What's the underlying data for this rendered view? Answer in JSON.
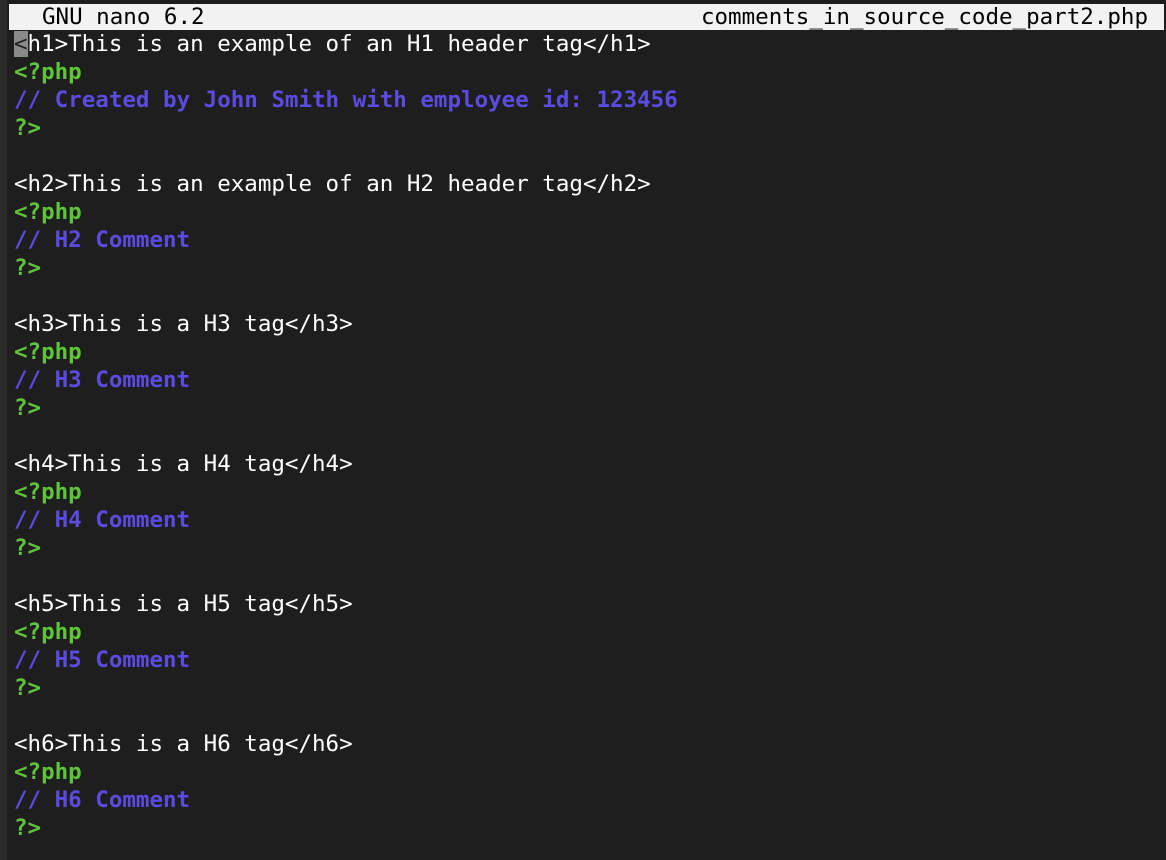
{
  "title_bar": {
    "app_name": "GNU nano 6.2",
    "file_name": "comments_in_source_code_part2.php"
  },
  "cursor_char": "<",
  "lines": [
    {
      "text": "h1>This is an example of an H1 header tag</h1>",
      "kind": "html",
      "cursor": true
    },
    {
      "text": "<?php",
      "kind": "php"
    },
    {
      "text": "// Created by John Smith with employee id: 123456",
      "kind": "comment"
    },
    {
      "text": "?>",
      "kind": "php"
    },
    {
      "text": "",
      "kind": "blank"
    },
    {
      "text": "<h2>This is an example of an H2 header tag</h2>",
      "kind": "html"
    },
    {
      "text": "<?php",
      "kind": "php"
    },
    {
      "text": "// H2 Comment",
      "kind": "comment"
    },
    {
      "text": "?>",
      "kind": "php"
    },
    {
      "text": "",
      "kind": "blank"
    },
    {
      "text": "<h3>This is a H3 tag</h3>",
      "kind": "html"
    },
    {
      "text": "<?php",
      "kind": "php"
    },
    {
      "text": "// H3 Comment",
      "kind": "comment"
    },
    {
      "text": "?>",
      "kind": "php"
    },
    {
      "text": "",
      "kind": "blank"
    },
    {
      "text": "<h4>This is a H4 tag</h4>",
      "kind": "html"
    },
    {
      "text": "<?php",
      "kind": "php"
    },
    {
      "text": "// H4 Comment",
      "kind": "comment"
    },
    {
      "text": "?>",
      "kind": "php"
    },
    {
      "text": "",
      "kind": "blank"
    },
    {
      "text": "<h5>This is a H5 tag</h5>",
      "kind": "html"
    },
    {
      "text": "<?php",
      "kind": "php"
    },
    {
      "text": "// H5 Comment",
      "kind": "comment"
    },
    {
      "text": "?>",
      "kind": "php"
    },
    {
      "text": "",
      "kind": "blank"
    },
    {
      "text": "<h6>This is a H6 tag</h6>",
      "kind": "html"
    },
    {
      "text": "<?php",
      "kind": "php"
    },
    {
      "text": "// H6 Comment",
      "kind": "comment"
    },
    {
      "text": "?>",
      "kind": "php"
    }
  ],
  "colors": {
    "background": "#1e1e1e",
    "title_bar": "#f2f2f2",
    "html_text": "#ffffff",
    "php_tag": "#5fc43a",
    "comment": "#5b4be0",
    "cursor": "#8a8a8a"
  }
}
